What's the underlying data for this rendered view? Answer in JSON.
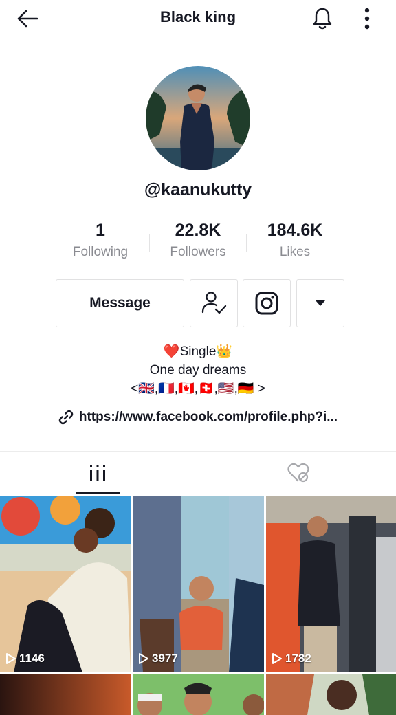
{
  "header": {
    "title": "Black king",
    "back_icon": "arrow-left-icon",
    "bell_icon": "bell-icon",
    "more_icon": "vertical-dots-icon"
  },
  "profile": {
    "handle": "@kaanukutty",
    "avatar_icon": "profile-photo"
  },
  "stats": [
    {
      "value": "1",
      "label": "Following"
    },
    {
      "value": "22.8K",
      "label": "Followers"
    },
    {
      "value": "184.6K",
      "label": "Likes"
    }
  ],
  "actions": {
    "message_label": "Message",
    "follow_icon": "person-check-icon",
    "instagram_icon": "instagram-icon",
    "dropdown_icon": "triangle-down-icon"
  },
  "bio": {
    "line1": "❤️Single👑",
    "line2": "One day dreams",
    "line3": "<🇬🇧,🇫🇷,🇨🇦,🇨🇭,🇺🇸,🇩🇪 >"
  },
  "link": {
    "icon": "link-icon",
    "text": "https://www.facebook.com/profile.php?i..."
  },
  "tabs": [
    {
      "name": "videos",
      "icon": "grid-bars-icon",
      "active": true
    },
    {
      "name": "liked",
      "icon": "heart-hidden-icon",
      "active": false
    }
  ],
  "videos": [
    {
      "views": "1146"
    },
    {
      "views": "3977"
    },
    {
      "views": "1782"
    },
    {
      "views": ""
    },
    {
      "views": ""
    },
    {
      "views": ""
    }
  ],
  "colors": {
    "text_primary": "#161823",
    "text_secondary": "#8a8b91",
    "border": "#e1e1e2"
  }
}
